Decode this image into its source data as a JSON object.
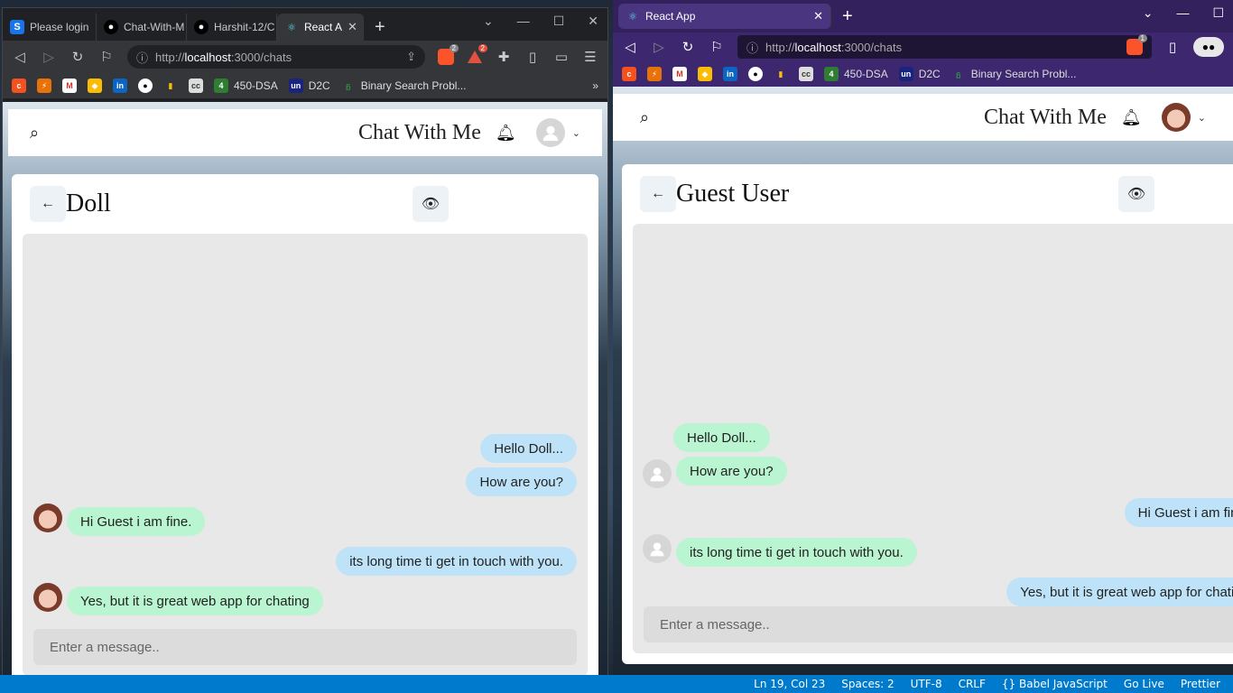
{
  "left": {
    "tabs": [
      {
        "label": "Please login",
        "icon": "S"
      },
      {
        "label": "Chat-With-M",
        "icon": "github"
      },
      {
        "label": "Harshit-12/C",
        "icon": "github"
      },
      {
        "label": "React A",
        "icon": "react"
      }
    ],
    "url": {
      "prefix": "http://",
      "host": "localhost",
      "path": ":3000/chats"
    },
    "brave_count": "2",
    "rewards_count": "2",
    "bookmarks": [
      "450-DSA",
      "D2C",
      "Binary Search Probl..."
    ],
    "app_title": "Chat With Me",
    "chat_name": "Doll",
    "messages": [
      {
        "text": "Hello Doll...",
        "type": "sent"
      },
      {
        "text": "How are you?",
        "type": "sent"
      },
      {
        "text": "Hi Guest i am fine.",
        "type": "recv"
      },
      {
        "text": "its long time ti get in touch with you.",
        "type": "sent"
      },
      {
        "text": "Yes, but it is great web app for chating",
        "type": "recv"
      }
    ],
    "input_placeholder": "Enter a message.."
  },
  "right": {
    "tabs": [
      {
        "label": "React App",
        "icon": "react"
      }
    ],
    "url": {
      "prefix": "http://",
      "host": "localhost",
      "path": ":3000/chats"
    },
    "brave_count": "1",
    "bookmarks": [
      "450-DSA",
      "D2C",
      "Binary Search Probl..."
    ],
    "app_title": "Chat With Me",
    "chat_name": "Guest User",
    "messages": [
      {
        "text": "Hello Doll...",
        "type": "recv"
      },
      {
        "text": "How are you?",
        "type": "recv"
      },
      {
        "text": "Hi Guest i am fine.",
        "type": "sent"
      },
      {
        "text": "its long time ti get in touch with you.",
        "type": "recv"
      },
      {
        "text": "Yes, but it is great web app for chating",
        "type": "sent"
      }
    ],
    "input_placeholder": "Enter a message.."
  },
  "statusbar": [
    "Ln 19, Col 23",
    "Spaces: 2",
    "UTF-8",
    "CRLF",
    "{} Babel JavaScript",
    "Go Live",
    "Prettier"
  ],
  "colors": {
    "sent_bubble": "#bee3f8",
    "recv_bubble": "#b9f5d0",
    "status_blue": "#007acc",
    "brave_purple": "#33215e"
  }
}
